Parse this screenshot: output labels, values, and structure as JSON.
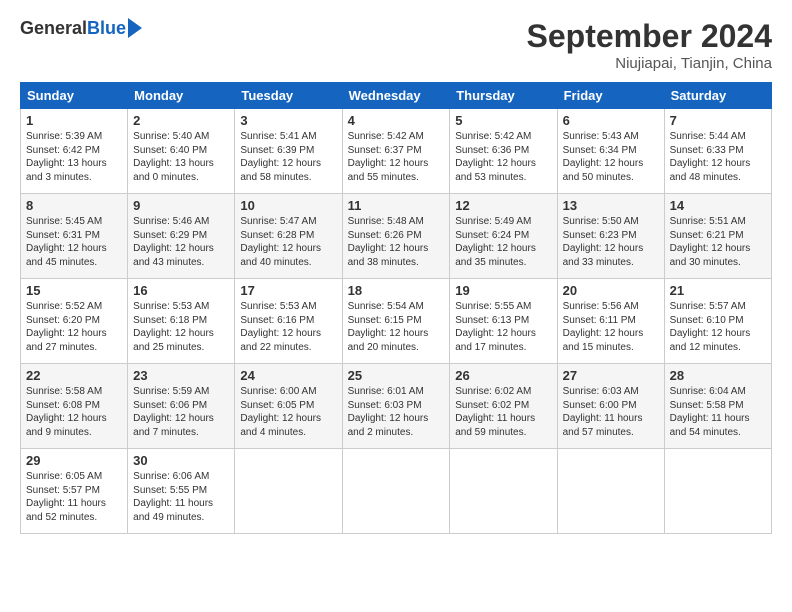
{
  "logo": {
    "general": "General",
    "blue": "Blue"
  },
  "header": {
    "title": "September 2024",
    "location": "Niujiapai, Tianjin, China"
  },
  "weekdays": [
    "Sunday",
    "Monday",
    "Tuesday",
    "Wednesday",
    "Thursday",
    "Friday",
    "Saturday"
  ],
  "weeks": [
    [
      {
        "day": "1",
        "info": "Sunrise: 5:39 AM\nSunset: 6:42 PM\nDaylight: 13 hours\nand 3 minutes."
      },
      {
        "day": "2",
        "info": "Sunrise: 5:40 AM\nSunset: 6:40 PM\nDaylight: 13 hours\nand 0 minutes."
      },
      {
        "day": "3",
        "info": "Sunrise: 5:41 AM\nSunset: 6:39 PM\nDaylight: 12 hours\nand 58 minutes."
      },
      {
        "day": "4",
        "info": "Sunrise: 5:42 AM\nSunset: 6:37 PM\nDaylight: 12 hours\nand 55 minutes."
      },
      {
        "day": "5",
        "info": "Sunrise: 5:42 AM\nSunset: 6:36 PM\nDaylight: 12 hours\nand 53 minutes."
      },
      {
        "day": "6",
        "info": "Sunrise: 5:43 AM\nSunset: 6:34 PM\nDaylight: 12 hours\nand 50 minutes."
      },
      {
        "day": "7",
        "info": "Sunrise: 5:44 AM\nSunset: 6:33 PM\nDaylight: 12 hours\nand 48 minutes."
      }
    ],
    [
      {
        "day": "8",
        "info": "Sunrise: 5:45 AM\nSunset: 6:31 PM\nDaylight: 12 hours\nand 45 minutes."
      },
      {
        "day": "9",
        "info": "Sunrise: 5:46 AM\nSunset: 6:29 PM\nDaylight: 12 hours\nand 43 minutes."
      },
      {
        "day": "10",
        "info": "Sunrise: 5:47 AM\nSunset: 6:28 PM\nDaylight: 12 hours\nand 40 minutes."
      },
      {
        "day": "11",
        "info": "Sunrise: 5:48 AM\nSunset: 6:26 PM\nDaylight: 12 hours\nand 38 minutes."
      },
      {
        "day": "12",
        "info": "Sunrise: 5:49 AM\nSunset: 6:24 PM\nDaylight: 12 hours\nand 35 minutes."
      },
      {
        "day": "13",
        "info": "Sunrise: 5:50 AM\nSunset: 6:23 PM\nDaylight: 12 hours\nand 33 minutes."
      },
      {
        "day": "14",
        "info": "Sunrise: 5:51 AM\nSunset: 6:21 PM\nDaylight: 12 hours\nand 30 minutes."
      }
    ],
    [
      {
        "day": "15",
        "info": "Sunrise: 5:52 AM\nSunset: 6:20 PM\nDaylight: 12 hours\nand 27 minutes."
      },
      {
        "day": "16",
        "info": "Sunrise: 5:53 AM\nSunset: 6:18 PM\nDaylight: 12 hours\nand 25 minutes."
      },
      {
        "day": "17",
        "info": "Sunrise: 5:53 AM\nSunset: 6:16 PM\nDaylight: 12 hours\nand 22 minutes."
      },
      {
        "day": "18",
        "info": "Sunrise: 5:54 AM\nSunset: 6:15 PM\nDaylight: 12 hours\nand 20 minutes."
      },
      {
        "day": "19",
        "info": "Sunrise: 5:55 AM\nSunset: 6:13 PM\nDaylight: 12 hours\nand 17 minutes."
      },
      {
        "day": "20",
        "info": "Sunrise: 5:56 AM\nSunset: 6:11 PM\nDaylight: 12 hours\nand 15 minutes."
      },
      {
        "day": "21",
        "info": "Sunrise: 5:57 AM\nSunset: 6:10 PM\nDaylight: 12 hours\nand 12 minutes."
      }
    ],
    [
      {
        "day": "22",
        "info": "Sunrise: 5:58 AM\nSunset: 6:08 PM\nDaylight: 12 hours\nand 9 minutes."
      },
      {
        "day": "23",
        "info": "Sunrise: 5:59 AM\nSunset: 6:06 PM\nDaylight: 12 hours\nand 7 minutes."
      },
      {
        "day": "24",
        "info": "Sunrise: 6:00 AM\nSunset: 6:05 PM\nDaylight: 12 hours\nand 4 minutes."
      },
      {
        "day": "25",
        "info": "Sunrise: 6:01 AM\nSunset: 6:03 PM\nDaylight: 12 hours\nand 2 minutes."
      },
      {
        "day": "26",
        "info": "Sunrise: 6:02 AM\nSunset: 6:02 PM\nDaylight: 11 hours\nand 59 minutes."
      },
      {
        "day": "27",
        "info": "Sunrise: 6:03 AM\nSunset: 6:00 PM\nDaylight: 11 hours\nand 57 minutes."
      },
      {
        "day": "28",
        "info": "Sunrise: 6:04 AM\nSunset: 5:58 PM\nDaylight: 11 hours\nand 54 minutes."
      }
    ],
    [
      {
        "day": "29",
        "info": "Sunrise: 6:05 AM\nSunset: 5:57 PM\nDaylight: 11 hours\nand 52 minutes."
      },
      {
        "day": "30",
        "info": "Sunrise: 6:06 AM\nSunset: 5:55 PM\nDaylight: 11 hours\nand 49 minutes."
      },
      {
        "day": "",
        "info": ""
      },
      {
        "day": "",
        "info": ""
      },
      {
        "day": "",
        "info": ""
      },
      {
        "day": "",
        "info": ""
      },
      {
        "day": "",
        "info": ""
      }
    ]
  ]
}
